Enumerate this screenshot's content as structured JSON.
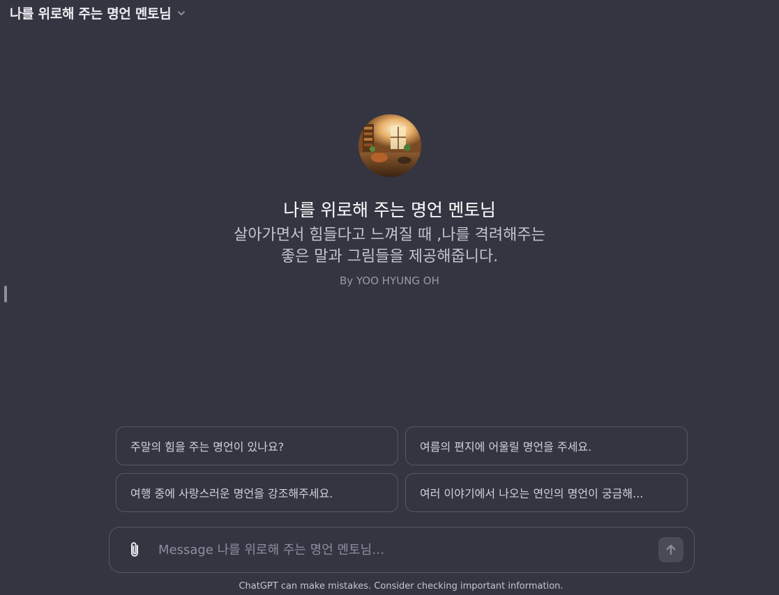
{
  "header": {
    "title": "나를 위로해 주는 명언 멘토님"
  },
  "gpt": {
    "name": "나를 위로해 주는 명언 멘토님",
    "description_line1": "살아가면서 힘들다고 느껴질 때 ,나를 격려해주는",
    "description_line2": "좋은 말과 그림들을 제공해줍니다.",
    "author": "By YOO HYUNG OH"
  },
  "starters": [
    {
      "label": "주말의 힘을 주는 명언이 있나요?"
    },
    {
      "label": "여름의 편지에 어울릴 명언을 주세요."
    },
    {
      "label": "여행 중에 사랑스러운 명언을 강조해주세요."
    },
    {
      "label": "여러 이야기에서 나오는 연인의 명언이 궁금해..."
    }
  ],
  "composer": {
    "placeholder": "Message 나를 위로해 주는 명언 멘토님…"
  },
  "footer": {
    "disclaimer": "ChatGPT can make mistakes. Consider checking important information."
  },
  "icons": {
    "header_chevron": "chevron-down-icon",
    "attach": "paperclip-icon",
    "send": "arrow-up-icon"
  }
}
